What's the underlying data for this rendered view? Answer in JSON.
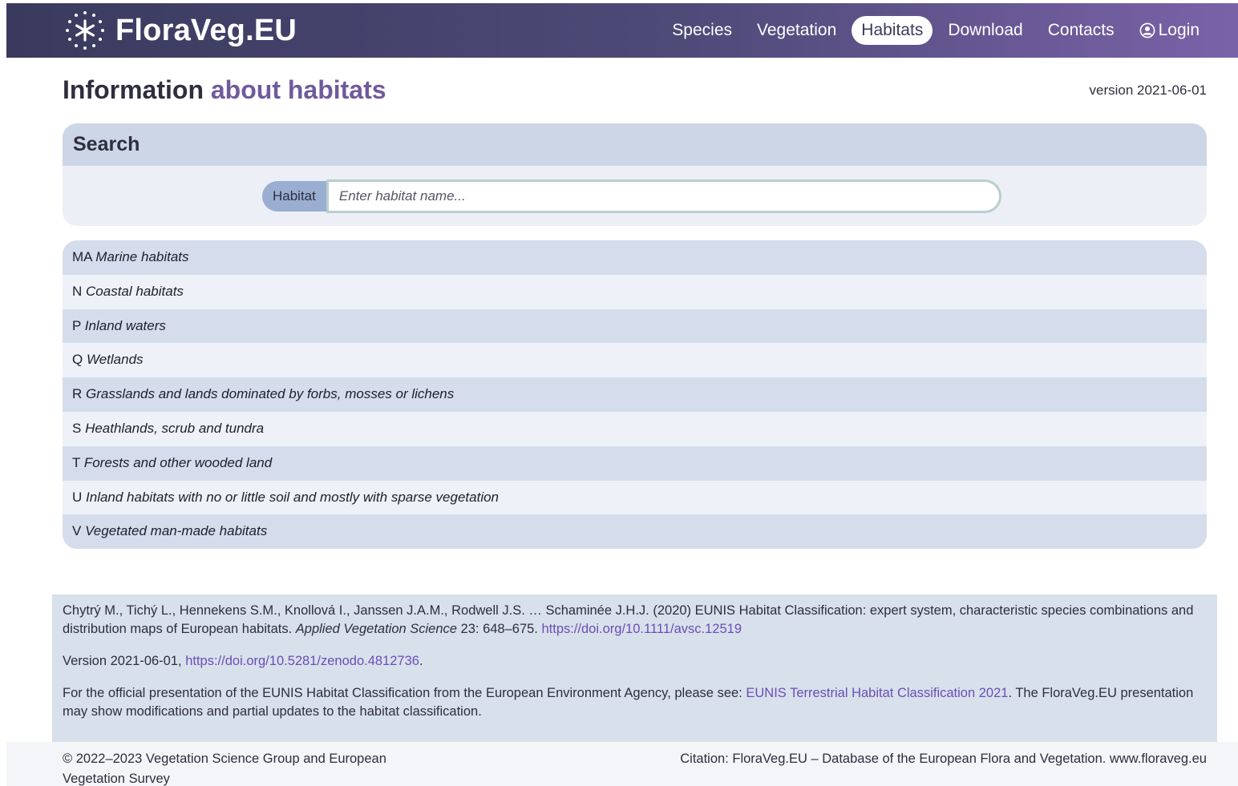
{
  "nav": {
    "brand": "FloraVeg.EU",
    "items": [
      {
        "label": "Species",
        "active": false
      },
      {
        "label": "Vegetation",
        "active": false
      },
      {
        "label": "Habitats",
        "active": true
      },
      {
        "label": "Download",
        "active": false
      },
      {
        "label": "Contacts",
        "active": false
      }
    ],
    "login_label": "Login",
    "login_icon": "user-circle-icon",
    "logo_icon": "star-circle-logo-icon"
  },
  "page": {
    "title_prefix": "Information",
    "title_accent": "about habitats",
    "version": "version 2021-06-01"
  },
  "search": {
    "header": "Search",
    "label": "Habitat",
    "placeholder": "Enter habitat name...",
    "value": ""
  },
  "habitats": [
    {
      "code": "MA",
      "name": "Marine habitats"
    },
    {
      "code": "N",
      "name": "Coastal habitats"
    },
    {
      "code": "P",
      "name": "Inland waters"
    },
    {
      "code": "Q",
      "name": "Wetlands"
    },
    {
      "code": "R",
      "name": "Grasslands and lands dominated by forbs, mosses or lichens"
    },
    {
      "code": "S",
      "name": "Heathlands, scrub and tundra"
    },
    {
      "code": "T",
      "name": "Forests and other wooded land"
    },
    {
      "code": "U",
      "name": "Inland habitats with no or little soil and mostly with sparse vegetation"
    },
    {
      "code": "V",
      "name": "Vegetated man-made habitats"
    }
  ],
  "footer": {
    "citation_text": "Chytrý M., Tichý L., Hennekens S.M., Knollová I., Janssen J.A.M., Rodwell J.S. … Schaminée J.H.J. (2020) EUNIS Habitat Classification: expert system, characteristic species combinations and distribution maps of European habitats. ",
    "journal": "Applied Vegetation Science",
    "pages": " 23: 648–675. ",
    "doi_link": "https://doi.org/10.1111/avsc.12519",
    "version_prefix": "Version 2021-06-01, ",
    "version_link": "https://doi.org/10.5281/zenodo.4812736",
    "version_suffix": ".",
    "eea_prefix": "For the official presentation of the EUNIS Habitat Classification from the European Environment Agency, please see: ",
    "eea_link": "EUNIS Terrestrial Habitat Classification 2021",
    "eea_suffix": ". The FloraVeg.EU presentation may show modifications and partial updates to the habitat classification."
  },
  "bottom": {
    "copyright": "© 2022–2023 Vegetation Science Group and European Vegetation Survey",
    "citation": "Citation: FloraVeg.EU – Database of the European Flora and Vegetation. www.floraveg.eu"
  },
  "colors": {
    "nav_start": "#3a3a5e",
    "nav_end": "#7a62a8",
    "accent": "#6f5a9c",
    "link": "#6a4fb5"
  }
}
